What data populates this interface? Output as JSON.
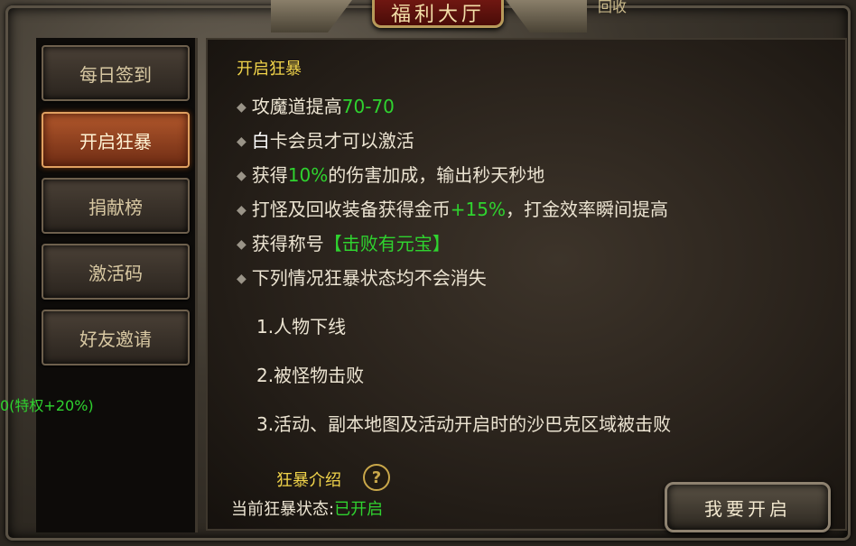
{
  "window": {
    "title": "福利大厅",
    "top_right_text": "回收"
  },
  "sidebar": {
    "items": [
      {
        "label": "每日签到",
        "active": false
      },
      {
        "label": "开启狂暴",
        "active": true
      },
      {
        "label": "捐献榜",
        "active": false
      },
      {
        "label": "激活码",
        "active": false
      },
      {
        "label": "好友邀请",
        "active": false
      }
    ],
    "privilege_text": "0(特权+20%)"
  },
  "content": {
    "title": "开启狂暴",
    "bullets": [
      {
        "pre": "攻魔道提高",
        "hl": "70-70",
        "post": "",
        "hl_color": "green"
      },
      {
        "pre": "",
        "hl": "白",
        "post": "卡会员才可以激活",
        "hl_color": "white"
      },
      {
        "pre": "获得",
        "hl": "10%",
        "post": "的伤害加成，输出秒天秒地",
        "hl_color": "green"
      },
      {
        "pre": "打怪及回收装备获得金币",
        "hl": "+15%",
        "post": "，打金效率瞬间提高",
        "hl_color": "green"
      },
      {
        "pre": "获得称号",
        "hl": "【击败有元宝】",
        "post": "",
        "hl_color": "green"
      },
      {
        "pre": "下列情况狂暴状态均不会消失",
        "hl": "",
        "post": "",
        "hl_color": "green"
      }
    ],
    "conditions": [
      "1.人物下线",
      "2.被怪物击败",
      "3.活动、副本地图及活动开启时的沙巴克区域被击败"
    ],
    "intro_label": "狂暴介绍",
    "status_label": "当前狂暴状态:",
    "status_value": "已开启",
    "open_button": "我要开启"
  },
  "icons": {
    "bullet": "diamond-icon",
    "help": "question-mark-icon"
  },
  "colors": {
    "highlight_green": "#2fd32f",
    "title_gold": "#f0d34a",
    "active_tab": "#b2582c"
  }
}
